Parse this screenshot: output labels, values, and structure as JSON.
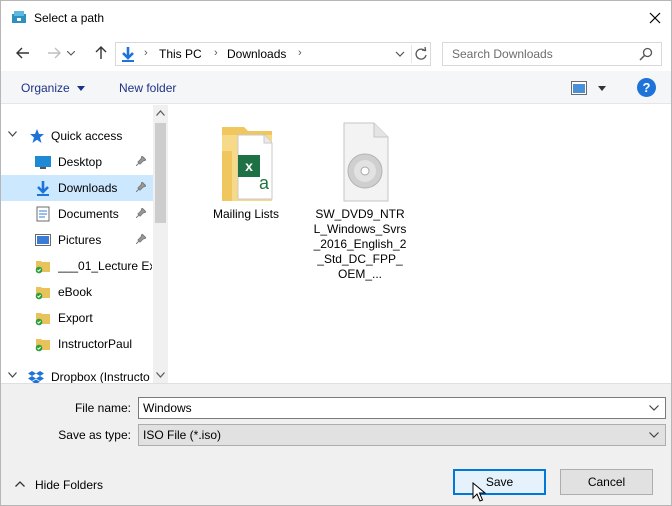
{
  "window": {
    "title": "Select a path"
  },
  "address_bar": {
    "crumbs": [
      "This PC",
      "Downloads"
    ]
  },
  "search": {
    "placeholder": "Search Downloads"
  },
  "toolbar": {
    "organize_label": "Organize",
    "new_folder_label": "New folder",
    "help_label": "?"
  },
  "nav_pane": {
    "items": [
      {
        "label": "Quick access",
        "icon": "star-icon",
        "expander": "expanded",
        "pinned": false
      },
      {
        "label": "Desktop",
        "icon": "desktop-icon",
        "pinned": true
      },
      {
        "label": "Downloads",
        "icon": "download-arrow-icon",
        "pinned": true,
        "selected": true
      },
      {
        "label": "Documents",
        "icon": "documents-icon",
        "pinned": true
      },
      {
        "label": "Pictures",
        "icon": "pictures-icon",
        "pinned": true
      },
      {
        "label": "___01_Lecture Ex",
        "icon": "synced-folder-icon",
        "pinned": false
      },
      {
        "label": "eBook",
        "icon": "synced-folder-icon",
        "pinned": false
      },
      {
        "label": "Export",
        "icon": "synced-folder-icon",
        "pinned": false
      },
      {
        "label": "InstructorPaul",
        "icon": "synced-folder-icon",
        "pinned": false
      },
      {
        "label": "Dropbox (Instructo",
        "icon": "dropbox-icon",
        "expander": "expanded",
        "pinned": false
      }
    ]
  },
  "files": [
    {
      "label": "Mailing Lists",
      "icon": "excel-folder-icon"
    },
    {
      "label": "SW_DVD9_NTRL_Windows_Svrs_2016_English_2_Std_DC_FPP_OEM_...",
      "icon": "disc-image-file-icon"
    }
  ],
  "bottom": {
    "file_name_label": "File name:",
    "file_name_value": "Windows",
    "save_as_type_label": "Save as type:",
    "save_as_type_value": "ISO File (*.iso)",
    "hide_folders_label": "Hide Folders",
    "save_label": "Save",
    "cancel_label": "Cancel"
  },
  "colors": {
    "accent": "#0078d7",
    "selection": "#cce8ff",
    "link_text": "#1e3287",
    "help": "#1e73d8"
  }
}
